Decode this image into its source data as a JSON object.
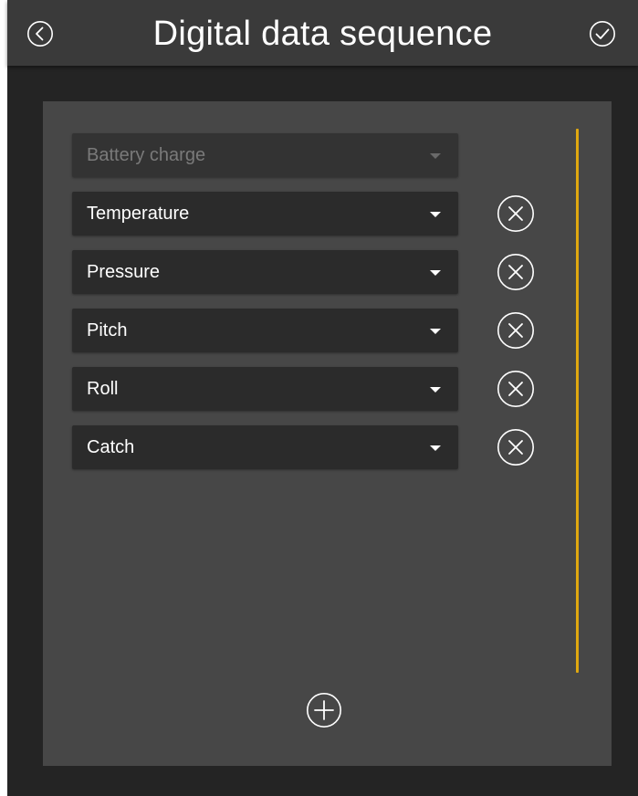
{
  "header": {
    "title": "Digital data sequence",
    "back_icon": "chevron-left-circle-icon",
    "confirm_icon": "check-circle-icon"
  },
  "sequence": {
    "items": [
      {
        "label": "Battery charge",
        "enabled": false,
        "removable": false
      },
      {
        "label": "Temperature",
        "enabled": true,
        "removable": true
      },
      {
        "label": "Pressure",
        "enabled": true,
        "removable": true
      },
      {
        "label": "Pitch",
        "enabled": true,
        "removable": true
      },
      {
        "label": "Roll",
        "enabled": true,
        "removable": true
      },
      {
        "label": "Catch",
        "enabled": true,
        "removable": true
      }
    ],
    "remove_icon": "x-circle-icon",
    "add_icon": "plus-circle-icon"
  },
  "colors": {
    "background": "#242424",
    "header": "#3a3a3a",
    "panel": "#474747",
    "field": "#2b2b2b",
    "scrollbar_accent": "#e0a810",
    "text": "#ffffff",
    "disabled_text": "#7a7a7a"
  }
}
